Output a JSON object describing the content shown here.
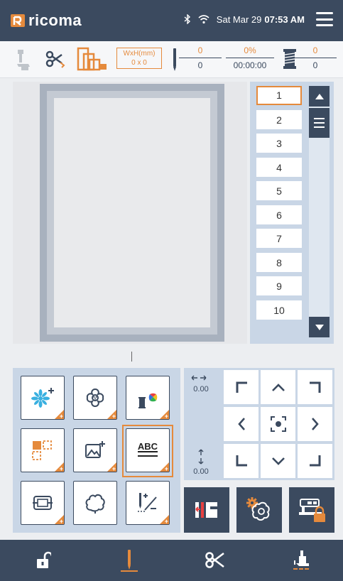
{
  "header": {
    "logo_text": "ricoma",
    "date": "Sat Mar 29",
    "time": "07:53 AM"
  },
  "toolbar": {
    "hoop_size_label": "WxH(mm)",
    "hoop_size_value": "0 x 0",
    "stitch_current": "0",
    "stitch_total": "0",
    "progress_percent": "0%",
    "elapsed_time": "00:00:00",
    "thread_current": "0",
    "thread_total": "0"
  },
  "color_list": {
    "items": [
      "1",
      "2",
      "3",
      "4",
      "5",
      "6",
      "7",
      "8",
      "9",
      "10"
    ],
    "selected_index": 0
  },
  "move_pad": {
    "x_offset": "0.00",
    "y_offset": "0.00"
  },
  "colors": {
    "accent": "#e58a3c",
    "primary": "#3b4a5f",
    "panel": "#c9d6e6"
  },
  "icons": {
    "tools": [
      "add-design-icon",
      "flower-design-icon",
      "color-thread-icon",
      "layout-icon",
      "add-image-icon",
      "text-abc-icon",
      "hoop-frame-icon",
      "applique-icon",
      "stitch-edit-icon"
    ],
    "nav": [
      "unlock-icon",
      "needle-icon",
      "scissors-icon",
      "presser-foot-icon"
    ]
  }
}
